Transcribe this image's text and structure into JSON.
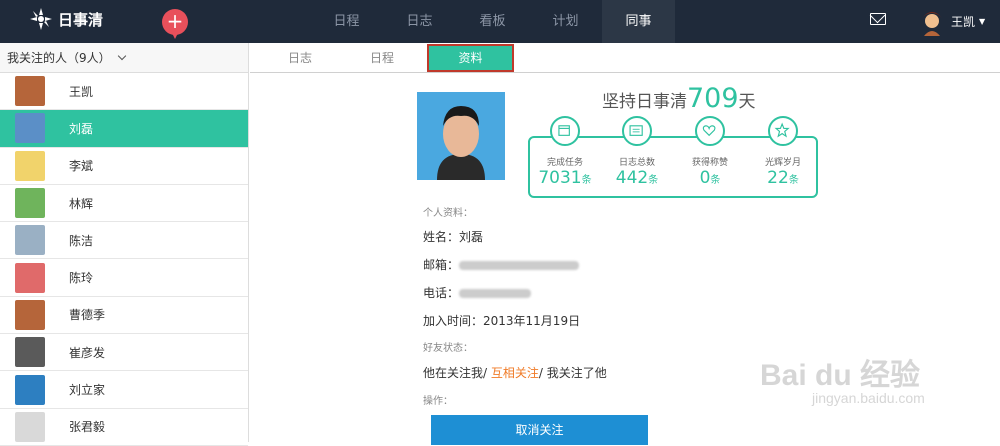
{
  "app": {
    "name": "日事清"
  },
  "nav": [
    {
      "label": "日程",
      "active": false
    },
    {
      "label": "日志",
      "active": false
    },
    {
      "label": "看板",
      "active": false
    },
    {
      "label": "计划",
      "active": false
    },
    {
      "label": "同事",
      "active": true
    }
  ],
  "header": {
    "user_name": "王凯",
    "add_icon": "plus-icon",
    "mail_icon": "mail-icon"
  },
  "sidebar": {
    "title": "我关注的人（9人）",
    "items": [
      {
        "name": "王凯",
        "active": false,
        "color": "#b5653a"
      },
      {
        "name": "刘磊",
        "active": true,
        "color": "#5b8fc7"
      },
      {
        "name": "李斌",
        "active": false,
        "color": "#f1d36b"
      },
      {
        "name": "林辉",
        "active": false,
        "color": "#6fb45c"
      },
      {
        "name": "陈洁",
        "active": false,
        "color": "#9ab0c4"
      },
      {
        "name": "陈玲",
        "active": false,
        "color": "#e06a6a"
      },
      {
        "name": "曹德季",
        "active": false,
        "color": "#b5653a"
      },
      {
        "name": "崔彦发",
        "active": false,
        "color": "#5a5a5a"
      },
      {
        "name": "刘立家",
        "active": false,
        "color": "#2d7fc1"
      },
      {
        "name": "张君毅",
        "active": false,
        "color": "#d9d9d9"
      }
    ]
  },
  "tabs": [
    {
      "label": "日志",
      "active": false
    },
    {
      "label": "日程",
      "active": false
    },
    {
      "label": "资料",
      "active": true
    }
  ],
  "profile": {
    "persist_prefix": "坚持日事清",
    "persist_days": "709",
    "persist_suffix": "天",
    "stats": [
      {
        "label": "完成任务",
        "value": "7031",
        "unit": "条",
        "icon": "calendar-icon"
      },
      {
        "label": "日志总数",
        "value": "442",
        "unit": "条",
        "icon": "list-icon"
      },
      {
        "label": "获得称赞",
        "value": "0",
        "unit": "条",
        "icon": "heart-icon"
      },
      {
        "label": "光辉岁月",
        "value": "22",
        "unit": "条",
        "icon": "star-icon"
      }
    ],
    "section_info": "个人资料：",
    "name_label": "姓名：刘磊",
    "email_label": "邮箱：",
    "phone_label": "电话：",
    "join_label": "加入时间：2013年11月19日",
    "section_friend": "好友状态：",
    "friend_a": "他在关注我/",
    "friend_b": "互相关注",
    "friend_c": "/ 我关注了他",
    "section_ops": "操作：",
    "unfollow_label": "取消关注"
  },
  "watermark": {
    "line1": "Bai du 经验",
    "line2": "jingyan.baidu.com"
  }
}
